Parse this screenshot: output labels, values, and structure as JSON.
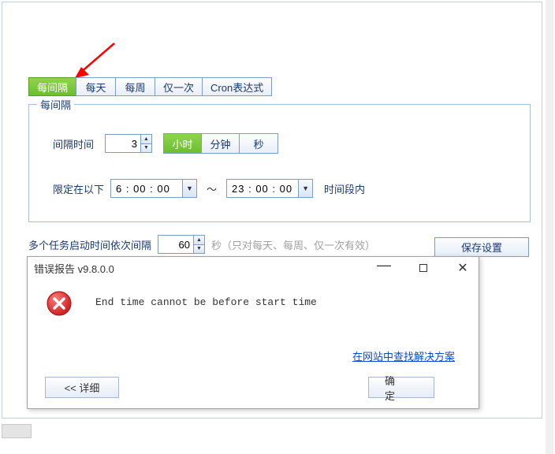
{
  "tabs": {
    "items": [
      {
        "label": "每间隔"
      },
      {
        "label": "每天"
      },
      {
        "label": "每周"
      },
      {
        "label": "仅一次"
      },
      {
        "label": "Cron表达式"
      }
    ],
    "selected_index": 0
  },
  "fieldset": {
    "legend": "每间隔",
    "interval_label": "间隔时间",
    "interval_value": "3",
    "units": [
      {
        "label": "小时"
      },
      {
        "label": "分钟"
      },
      {
        "label": "秒"
      }
    ],
    "units_selected_index": 0,
    "limit_label": "限定在以下",
    "start_time": "6 : 00 : 00",
    "tilde": "～",
    "end_time": "23 : 00 : 00",
    "range_suffix": "时间段内"
  },
  "below": {
    "multi_task_label": "多个任务启动时间依次间隔",
    "multi_task_value": "60",
    "multi_task_suffix": "秒（只对每天、每周、仅一次有效）",
    "save_label": "保存设置"
  },
  "dialog": {
    "title": "错误报告  v9.8.0.0",
    "message": "End time cannot be before start time",
    "help_link": "在网站中查找解决方案",
    "detail_label": "<<  详细",
    "ok_label": "确 定"
  }
}
